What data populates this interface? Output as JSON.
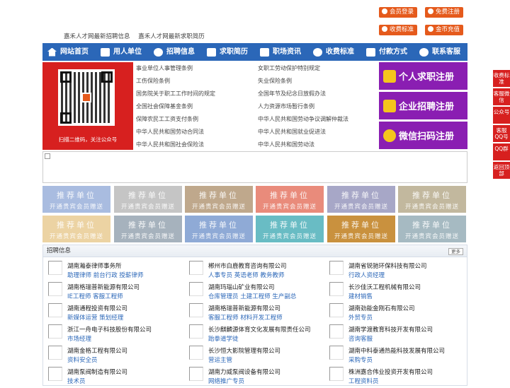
{
  "header": {
    "buttons": [
      {
        "label": "会员登录",
        "icon": "user-icon"
      },
      {
        "label": "免费注册",
        "icon": "user-add-icon"
      },
      {
        "label": "收费标准",
        "icon": "fee-icon"
      },
      {
        "label": "金币充值",
        "icon": "coin-icon"
      }
    ],
    "site_links": [
      "嘉禾人才网最新招聘信息",
      "嘉禾人才网最新求职简历"
    ]
  },
  "nav": {
    "items": [
      {
        "label": "网站首页",
        "icon": "home-icon"
      },
      {
        "label": "用人单位",
        "icon": "building-icon"
      },
      {
        "label": "招聘信息",
        "icon": "megaphone-icon"
      },
      {
        "label": "求职简历",
        "icon": "resume-icon"
      },
      {
        "label": "职场资讯",
        "icon": "news-icon"
      },
      {
        "label": "收费标准",
        "icon": "fee-icon"
      },
      {
        "label": "付款方式",
        "icon": "payment-icon"
      },
      {
        "label": "联系客服",
        "icon": "phone-icon"
      }
    ],
    "background": "#2b67b8"
  },
  "qr": {
    "caption": "扫描二维码，关注公众号"
  },
  "laws": [
    "事业单位人事管理条例",
    "女职工劳动保护特别规定",
    "工伤保险条例",
    "失业保险条例",
    "国务院关于职工工作时间的规定",
    "全国年节及纪念日放假办法",
    "全国社会保障基金条例",
    "人力资源市场暂行条例",
    "保障农民工工资支付条例",
    "中华人民共和国劳动争议调解仲裁法",
    "中华人民共和国劳动合同法",
    "中华人民共和国就业促进法",
    "中华人民共和国社会保险法",
    "中华人民共和国劳动法"
  ],
  "register": [
    {
      "label": "个人求职注册",
      "icon": "person-icon"
    },
    {
      "label": "企业招聘注册",
      "icon": "company-icon"
    },
    {
      "label": "微信扫码注册",
      "icon": "wechat-icon"
    }
  ],
  "float": [
    {
      "label": "收费标准"
    },
    {
      "label": "客服微信"
    },
    {
      "label": "公众号"
    },
    {
      "label": "客服QQ号"
    },
    {
      "label": "QQ群"
    },
    {
      "label": "返回顶部"
    }
  ],
  "recommend": {
    "title": "推荐单位",
    "subtitle": "开通贵宾会员赠送",
    "colors": [
      "#a9bce0",
      "#c5c5c5",
      "#bfa88c",
      "#e98b7b",
      "#a7a7c7",
      "#c2b89e",
      "#ecd3a3",
      "#a6b2bd",
      "#8faad6",
      "#69bcc4",
      "#c9913e",
      "#a6bac2"
    ]
  },
  "jobs": {
    "title": "招聘信息",
    "more": "更多",
    "items": [
      {
        "company": "湖南瀚泰律师事务所",
        "positions": "助理律师 前台行政 授薪律师"
      },
      {
        "company": "郴州市白鹿教育咨询有限公司",
        "positions": "人事专员 英语老师 教务教师"
      },
      {
        "company": "湖南省锐驰环保科技有限公司",
        "positions": "行政人资经理"
      },
      {
        "company": "湖南格瑞普新能源有限公司",
        "positions": "IE工程师 客服工程师"
      },
      {
        "company": "湖南玛瑙山矿业有限公司",
        "positions": "仓库管理员 土建工程师 生产副总"
      },
      {
        "company": "长沙佳沃工程机械有限公司",
        "positions": "建材销售"
      },
      {
        "company": "湖南通程投资有限公司",
        "positions": "新媒体运营 策划经理"
      },
      {
        "company": "湖南格瑞普新能源有限公司",
        "positions": "客服工程师 材料开发工程师"
      },
      {
        "company": "湖南劲能金刚石有限公司",
        "positions": "外贸专员"
      },
      {
        "company": "浙江一舟电子科技股份有限公司",
        "positions": "市场经理"
      },
      {
        "company": "长沙麒麟源体育文化发展有限责任公司",
        "positions": "跆拳道学徒"
      },
      {
        "company": "湖南学渡教育科技开发有限公司",
        "positions": "咨询客服"
      },
      {
        "company": "湖南金格工程有限公司",
        "positions": "资料安全员"
      },
      {
        "company": "长沙恒大影院管理有限公司",
        "positions": "营运主管"
      },
      {
        "company": "湖南中科泰通热能科技发展有限公司",
        "positions": "采购专员"
      },
      {
        "company": "湖南泵阀制造有限公司",
        "positions": "技术员"
      },
      {
        "company": "湖南力威泵阀设备有限公司",
        "positions": "网络推广专员"
      },
      {
        "company": "株洲嘉合伟业投资开发有限公司",
        "positions": "工程资料员"
      }
    ]
  }
}
